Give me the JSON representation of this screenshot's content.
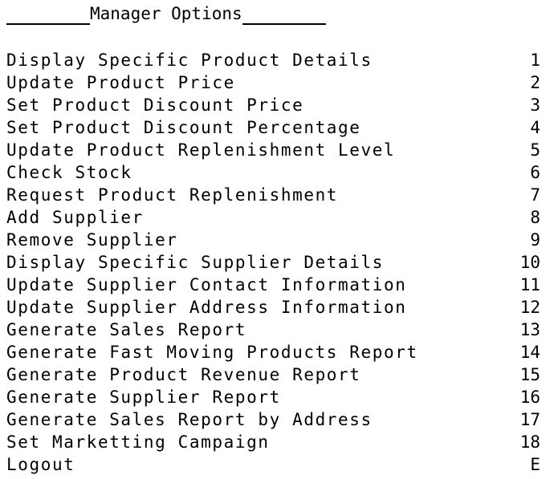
{
  "console": {
    "title": "Manager Options",
    "menu_items": [
      {
        "label": "Display Specific Product Details",
        "key": "1"
      },
      {
        "label": "Update Product Price",
        "key": "2"
      },
      {
        "label": "Set Product Discount Price",
        "key": "3"
      },
      {
        "label": "Set Product Discount Percentage",
        "key": "4"
      },
      {
        "label": "Update Product Replenishment Level",
        "key": "5"
      },
      {
        "label": "Check Stock",
        "key": "6"
      },
      {
        "label": "Request Product Replenishment",
        "key": "7"
      },
      {
        "label": "Add Supplier",
        "key": "8"
      },
      {
        "label": "Remove Supplier",
        "key": "9"
      },
      {
        "label": "Display Specific Supplier Details",
        "key": "10"
      },
      {
        "label": "Update Supplier Contact Information",
        "key": "11"
      },
      {
        "label": "Update Supplier Address Information",
        "key": "12"
      },
      {
        "label": "Generate Sales Report",
        "key": "13"
      },
      {
        "label": "Generate Fast Moving Products Report",
        "key": "14"
      },
      {
        "label": "Generate Product Revenue Report",
        "key": "15"
      },
      {
        "label": "Generate Supplier Report",
        "key": "16"
      },
      {
        "label": "Generate Sales Report by Address",
        "key": "17"
      },
      {
        "label": "Set Marketting Campaign",
        "key": "18"
      },
      {
        "label": "Logout",
        "key": "E"
      }
    ]
  }
}
